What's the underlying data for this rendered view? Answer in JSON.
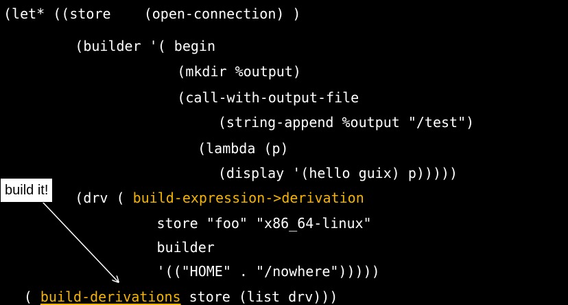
{
  "code": {
    "lines": [
      {
        "indent": "",
        "tokens": [
          {
            "text": "(let* ((store    (open-connection) )"
          }
        ]
      },
      {
        "indent": "       ",
        "tokens": [
          {
            "text": "(builder '( begin"
          }
        ]
      },
      {
        "indent": "                 ",
        "tokens": [
          {
            "text": "(mkdir %output)"
          }
        ]
      },
      {
        "indent": "                 ",
        "tokens": [
          {
            "text": "(call-with-output-file"
          }
        ]
      },
      {
        "indent": "                     ",
        "tokens": [
          {
            "text": "(string-append %output \"/test\")"
          }
        ]
      },
      {
        "indent": "                   ",
        "tokens": [
          {
            "text": "(lambda (p)"
          }
        ]
      },
      {
        "indent": "                     ",
        "tokens": [
          {
            "text": "(display '(hello guix) p)))))"
          }
        ]
      },
      {
        "indent": "       ",
        "tokens": [
          {
            "text": "(drv ( "
          },
          {
            "text": "build-expression->derivation",
            "highlight": true
          }
        ]
      },
      {
        "indent": "               ",
        "tokens": [
          {
            "text": "store \"foo\" \"x86_64-linux\""
          }
        ]
      },
      {
        "indent": "               ",
        "tokens": [
          {
            "text": "builder"
          }
        ]
      },
      {
        "indent": "               ",
        "tokens": [
          {
            "text": "'((\"HOME\" . \"/nowhere\")))))"
          }
        ]
      },
      {
        "indent": "  ",
        "tokens": [
          {
            "text": "( "
          },
          {
            "text": "build-derivations",
            "highlight": true,
            "underline": true
          },
          {
            "text": " store (list drv)))"
          }
        ]
      }
    ]
  },
  "callout": {
    "label": "build it!"
  },
  "colors": {
    "background": "#000000",
    "code": "#ffffff",
    "highlight": "#f5b400",
    "callout_bg": "#ffffff",
    "callout_text": "#000000",
    "arrow": "#ffffff"
  }
}
